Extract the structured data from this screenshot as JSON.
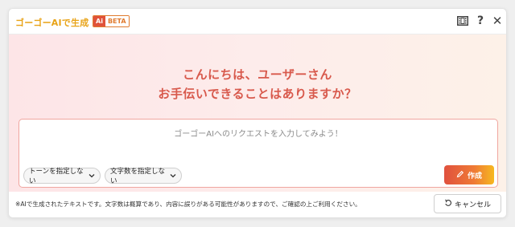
{
  "titlebar": {
    "app_title": "ゴーゴーAIで生成",
    "badge_ai": "Ai",
    "badge_beta": "BETA",
    "icons": [
      "film-icon",
      "help-icon",
      "close-icon"
    ],
    "help_glyph": "?",
    "close_glyph": "✕"
  },
  "hero": {
    "greeting_line1": "こんにちは、ユーザーさん",
    "greeting_line2": "お手伝いできることはありますか？"
  },
  "prompt": {
    "placeholder": "ゴーゴーAIへのリクエストを入力してみよう！",
    "value": ""
  },
  "options": {
    "tone_label": "トーンを指定しない",
    "length_label": "文字数を指定しない"
  },
  "actions": {
    "create_label": "作成",
    "cancel_label": "キャンセル"
  },
  "footer": {
    "disclaimer": "※AIで生成されたテキストです。文字数は概算であり、内容に誤りがある可能性がありますので、ご確認の上ご利用ください。"
  },
  "colors": {
    "accent_title": "#e8a317",
    "greeting": "#d8594c",
    "create_gradient_start": "#e0513e",
    "create_gradient_end": "#f6b820"
  }
}
